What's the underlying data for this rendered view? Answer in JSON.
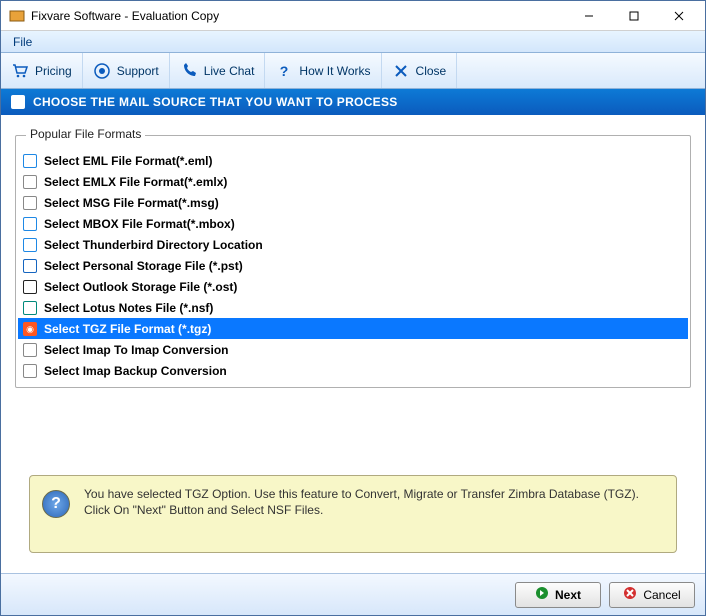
{
  "titlebar": {
    "title": "Fixvare Software - Evaluation Copy"
  },
  "menubar": {
    "file": "File"
  },
  "toolbar": {
    "pricing": "Pricing",
    "support": "Support",
    "livechat": "Live Chat",
    "howitworks": "How It Works",
    "close": "Close"
  },
  "section": {
    "heading": "CHOOSE THE MAIL SOURCE THAT YOU WANT TO PROCESS"
  },
  "group": {
    "legend": "Popular File Formats"
  },
  "formats": [
    {
      "label": "Select EML File Format(*.eml)",
      "selected": false,
      "iconColor": "#1e88e5",
      "iconText": "≡"
    },
    {
      "label": "Select EMLX File Format(*.emlx)",
      "selected": false,
      "iconColor": "#888888",
      "iconText": "✉"
    },
    {
      "label": "Select MSG File Format(*.msg)",
      "selected": false,
      "iconColor": "#888888",
      "iconText": "🗎"
    },
    {
      "label": "Select MBOX File Format(*.mbox)",
      "selected": false,
      "iconColor": "#1e88e5",
      "iconText": "≡"
    },
    {
      "label": "Select Thunderbird Directory Location",
      "selected": false,
      "iconColor": "#1e88e5",
      "iconText": "◔"
    },
    {
      "label": "Select Personal Storage File (*.pst)",
      "selected": false,
      "iconColor": "#1565c0",
      "iconText": "O"
    },
    {
      "label": "Select Outlook Storage File (*.ost)",
      "selected": false,
      "iconColor": "#222222",
      "iconText": "O"
    },
    {
      "label": "Select Lotus Notes File (*.nsf)",
      "selected": false,
      "iconColor": "#00897b",
      "iconText": "◧"
    },
    {
      "label": "Select TGZ File Format (*.tgz)",
      "selected": true,
      "iconColor": "#ff5722",
      "iconText": "◉"
    },
    {
      "label": "Select Imap To Imap Conversion",
      "selected": false,
      "iconColor": "#888888",
      "iconText": "⇆"
    },
    {
      "label": "Select Imap Backup Conversion",
      "selected": false,
      "iconColor": "#888888",
      "iconText": "⇆"
    }
  ],
  "info": {
    "message": "You have selected TGZ Option. Use this feature to Convert, Migrate or Transfer Zimbra Database (TGZ). Click On \"Next\" Button and Select NSF Files."
  },
  "footer": {
    "next": "Next",
    "cancel": "Cancel"
  }
}
